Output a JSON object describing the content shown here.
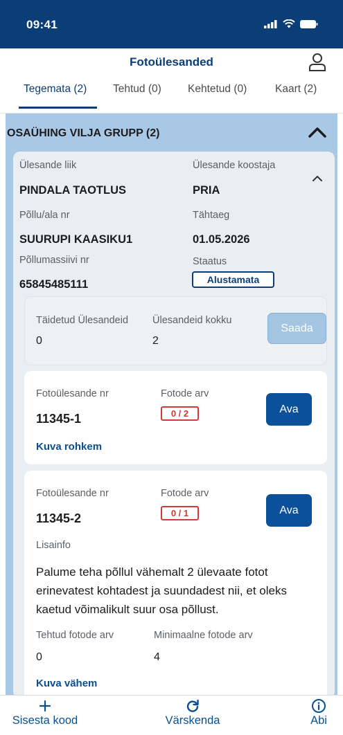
{
  "status_bar": {
    "time": "09:41"
  },
  "header": {
    "title": "Fotoülesanded"
  },
  "tabs": [
    {
      "label": "Tegemata (2)",
      "active": true
    },
    {
      "label": "Tehtud (0)",
      "active": false
    },
    {
      "label": "Kehtetud (0)",
      "active": false
    },
    {
      "label": "Kaart (2)",
      "active": false
    }
  ],
  "group": {
    "title": "OSAÜHING VILJA GRUPP (2)"
  },
  "task": {
    "type_label": "Ülesande liik",
    "type_value": "PINDALA TAOTLUS",
    "author_label": "Ülesande koostaja",
    "author_value": "PRIA",
    "field_label": "Põllu/ala nr",
    "field_value": "SUURUPI KAASIKU1",
    "deadline_label": "Tähtaeg",
    "deadline_value": "01.05.2026",
    "block_label": "Põllumassiivi nr",
    "block_value": "65845485111",
    "status_label": "Staatus",
    "status_value": "Alustamata"
  },
  "summary": {
    "completed_label": "Täidetud Ülesandeid",
    "completed_value": "0",
    "total_label": "Ülesandeid kokku",
    "total_value": "2",
    "send_label": "Saada"
  },
  "photo_tasks": [
    {
      "nr_label": "Fotoülesande nr",
      "nr_value": "11345-1",
      "count_label": "Fotode arv",
      "count_value": "0 / 2",
      "open_label": "Ava",
      "more_label": "Kuva rohkem"
    },
    {
      "nr_label": "Fotoülesande nr",
      "nr_value": "11345-2",
      "count_label": "Fotode arv",
      "count_value": "0 / 1",
      "open_label": "Ava",
      "info_label": "Lisainfo",
      "info_text": "Palume teha põllul vähemalt 2 ülevaate fotot erinevatest kohtadest ja suundadest nii, et oleks kaetud võimalikult suur osa põllust.",
      "taken_label": "Tehtud fotode arv",
      "taken_value": "0",
      "min_label": "Minimaalne fotode arv",
      "min_value": "4",
      "less_label": "Kuva vähem"
    }
  ],
  "bottom_nav": {
    "enter_code": "Sisesta kood",
    "refresh": "Värskenda",
    "help": "Abi"
  },
  "colors": {
    "primary": "#0b3d77",
    "group_background": "#a9c8e6",
    "danger": "#d6383a"
  }
}
